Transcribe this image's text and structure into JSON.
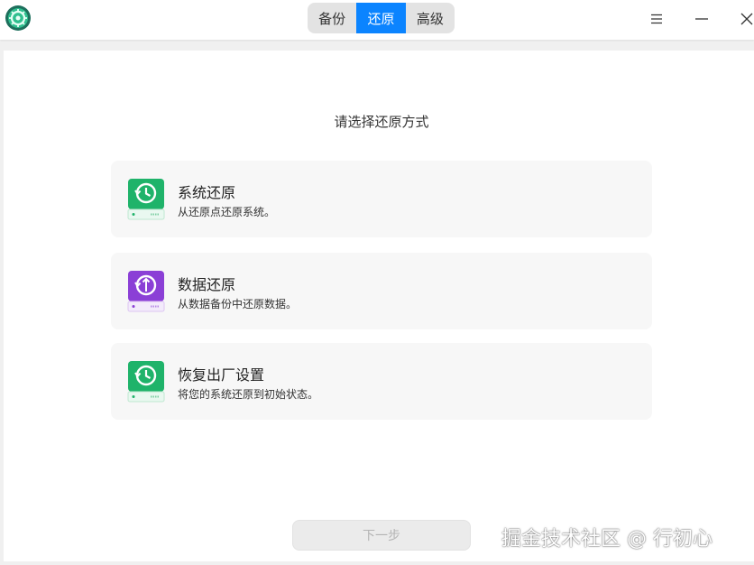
{
  "tabs": [
    {
      "label": "备份",
      "active": false
    },
    {
      "label": "还原",
      "active": true
    },
    {
      "label": "高级",
      "active": false
    }
  ],
  "heading": "请选择还原方式",
  "options": [
    {
      "title": "系统还原",
      "desc": "从还原点还原系统。",
      "icon": "system-restore-drive-icon",
      "color": "#1fb36a"
    },
    {
      "title": "数据还原",
      "desc": "从数据备份中还原数据。",
      "icon": "data-restore-drive-icon",
      "color": "#8b3fd6"
    },
    {
      "title": "恢复出厂设置",
      "desc": "将您的系统还原到初始状态。",
      "icon": "factory-reset-drive-icon",
      "color": "#1fb36a"
    }
  ],
  "next_button": "下一步",
  "watermark": "掘金技术社区 @ 行初心",
  "colors": {
    "accent": "#0b84ff",
    "green": "#1fb36a",
    "purple": "#8b3fd6"
  }
}
